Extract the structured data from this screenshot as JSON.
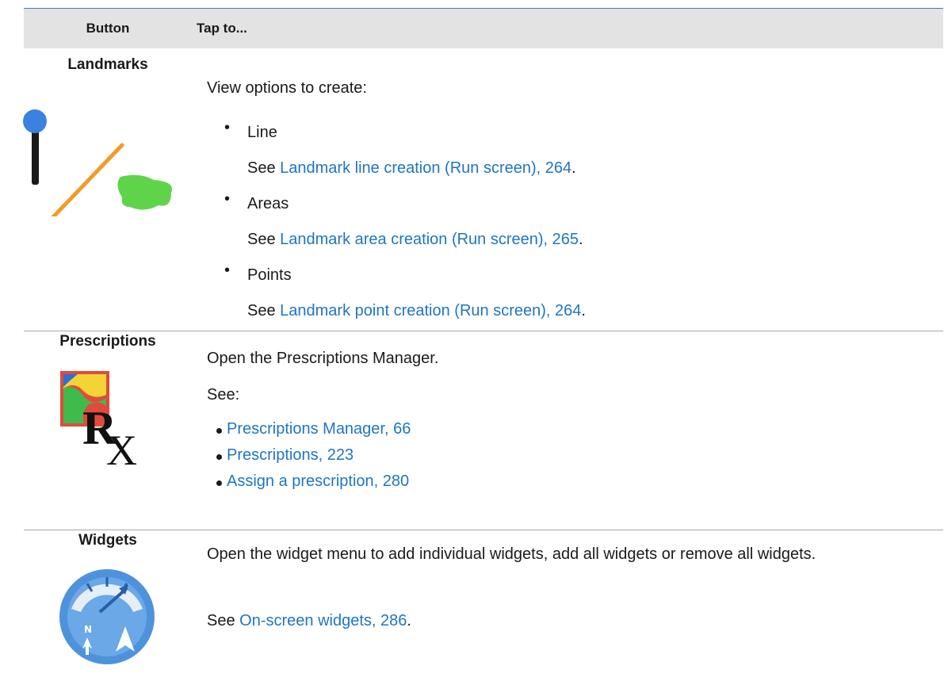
{
  "header": {
    "col_button": "Button",
    "col_tap": "Tap to..."
  },
  "rows": [
    {
      "name": "Landmarks",
      "icon": "landmarks-icon",
      "intro": "View options to create:",
      "items": [
        {
          "label": "Line",
          "see_prefix": "See ",
          "link": "Landmark line creation (Run screen), 264",
          "suffix": "."
        },
        {
          "label": "Areas",
          "see_prefix": "See ",
          "link": "Landmark area creation (Run screen), 265",
          "suffix": "."
        },
        {
          "label": "Points",
          "see_prefix": "See ",
          "link": "Landmark point creation (Run screen), 264",
          "suffix": "."
        }
      ]
    },
    {
      "name": "Prescriptions",
      "icon": "prescriptions-icon",
      "intro": "Open the Prescriptions Manager.",
      "see": "See:",
      "links": [
        "Prescriptions Manager, 66",
        "Prescriptions, 223",
        "Assign a prescription, 280"
      ]
    },
    {
      "name": "Widgets",
      "icon": "widgets-icon",
      "intro": "Open the widget menu to add individual widgets, add all widgets or remove all widgets.",
      "see_prefix": "See ",
      "link": "On-screen widgets, 286",
      "suffix": "."
    }
  ]
}
